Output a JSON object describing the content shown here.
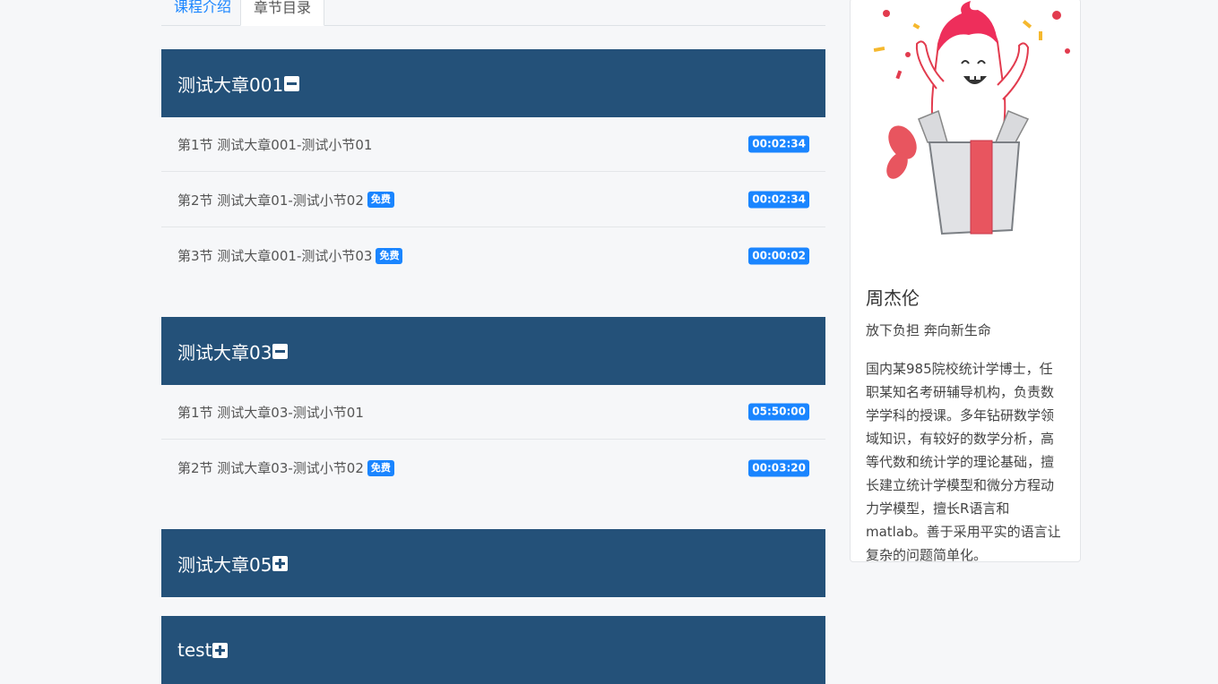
{
  "tabs": [
    {
      "label": "课程介绍",
      "active": false
    },
    {
      "label": "章节目录",
      "active": true
    }
  ],
  "chapters": [
    {
      "title": "测试大章001",
      "expanded": true,
      "lessons": [
        {
          "label": "第1节 测试大章001-测试小节01",
          "free": false,
          "duration": "00:02:34"
        },
        {
          "label": "第2节 测试大章01-测试小节02",
          "free": true,
          "duration": "00:02:34"
        },
        {
          "label": "第3节 测试大章001-测试小节03",
          "free": true,
          "duration": "00:00:02"
        }
      ]
    },
    {
      "title": "测试大章03",
      "expanded": true,
      "lessons": [
        {
          "label": "第1节 测试大章03-测试小节01",
          "free": false,
          "duration": "05:50:00"
        },
        {
          "label": "第2节 测试大章03-测试小节02",
          "free": true,
          "duration": "00:03:20"
        }
      ]
    },
    {
      "title": "测试大章05",
      "expanded": false,
      "lessons": []
    },
    {
      "title": "test",
      "expanded": false,
      "lessons": []
    }
  ],
  "free_badge_label": "免费",
  "teacher": {
    "avatar_icon": "gift-box-monster-icon",
    "name": "周杰伦",
    "motto": "放下负担 奔向新生命",
    "bio": "国内某985院校统计学博士，任职某知名考研辅导机构，负责数学学科的授课。多年钻研数学领域知识，有较好的数学分析，高等代数和统计学的理论基础，擅长建立统计学模型和微分方程动力学模型，擅长R语言和matlab。善于采用平实的语言让复杂的问题简单化。"
  },
  "colors": {
    "header_bg": "#245179",
    "accent": "#1a85ff",
    "page_bg": "#f6f7f9"
  }
}
